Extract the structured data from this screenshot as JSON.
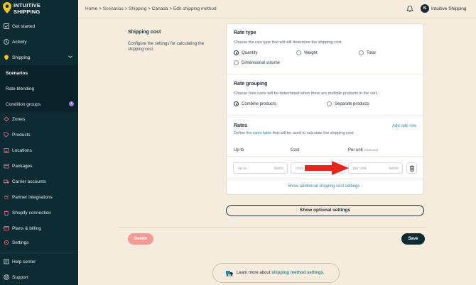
{
  "brand": {
    "line1": "INTUITIVE",
    "line2": "SHIPPING"
  },
  "sidebar": {
    "items": [
      {
        "label": "Get started",
        "icon": "rocket-icon"
      },
      {
        "label": "Activity",
        "icon": "activity-icon"
      },
      {
        "label": "Shipping",
        "icon": "shipping-icon"
      },
      {
        "label": "Scenarios"
      },
      {
        "label": "Rate blending"
      },
      {
        "label": "Condition groups",
        "badge": "i"
      },
      {
        "label": "Zones",
        "icon": "globe-icon"
      },
      {
        "label": "Products",
        "icon": "tag-icon"
      },
      {
        "label": "Locations",
        "icon": "building-icon"
      },
      {
        "label": "Packages",
        "icon": "package-icon"
      },
      {
        "label": "Carrier accounts",
        "icon": "truck-icon"
      },
      {
        "label": "Partner integrations",
        "icon": "partner-icon"
      },
      {
        "label": "Shopify connection",
        "icon": "shopify-icon"
      },
      {
        "label": "Plans & billing",
        "icon": "card-icon"
      },
      {
        "label": "Settings",
        "icon": "gear-icon"
      },
      {
        "label": "Help center",
        "icon": "help-icon"
      },
      {
        "label": "Support",
        "icon": "support-icon"
      }
    ]
  },
  "topbar": {
    "breadcrumb": "Home > Scenarios > Shipping > Canada > Edit shipping method",
    "avatar_initials": "IS",
    "user_name": "Intuitive Shipping"
  },
  "section": {
    "title": "Shipping cost",
    "description": "Configure the settings for calculating the shipping cost."
  },
  "rate_type": {
    "title": "Rate type",
    "description": "Choose the rate type that will will determine the shipping cost.",
    "options": [
      "Quantity",
      "Weight",
      "Total",
      "Dimensional volume"
    ],
    "selected": "Quantity"
  },
  "rate_grouping": {
    "title": "Rate grouping",
    "description": "Choose how costs will be determined when there are multiple products in the cart.",
    "options": [
      "Combine products",
      "Separate products"
    ],
    "selected": "Combine products"
  },
  "rates": {
    "title": "Rates",
    "description_pre": "Define the ",
    "description_link": "rates table",
    "description_post": " that will be used to calculate the shipping cost.",
    "add_link": "Add rate row",
    "col_up_to": "Up to",
    "col_cost": "Cost",
    "col_per_unit": "Per unit",
    "col_per_unit_note": "(Optional)",
    "up_to_placeholder": "up to",
    "up_to_suffix": "items",
    "cost_placeholder": "cost",
    "per_unit_placeholder": "per unit",
    "per_unit_suffix": "items",
    "show_additional": "Show additional shipping cost settings"
  },
  "buttons": {
    "show_optional": "Show optional settings",
    "delete": "Delete",
    "save": "Save"
  },
  "learn": {
    "pre": "Learn more about ",
    "link": "shipping method settings",
    "post": "."
  },
  "colors": {
    "sidebar_bg": "#0c2b33",
    "page_bg": "#f5ecdd",
    "accent_link": "#2a8aa0",
    "delete_bg": "#f29a93",
    "arrow": "#e8261b"
  }
}
